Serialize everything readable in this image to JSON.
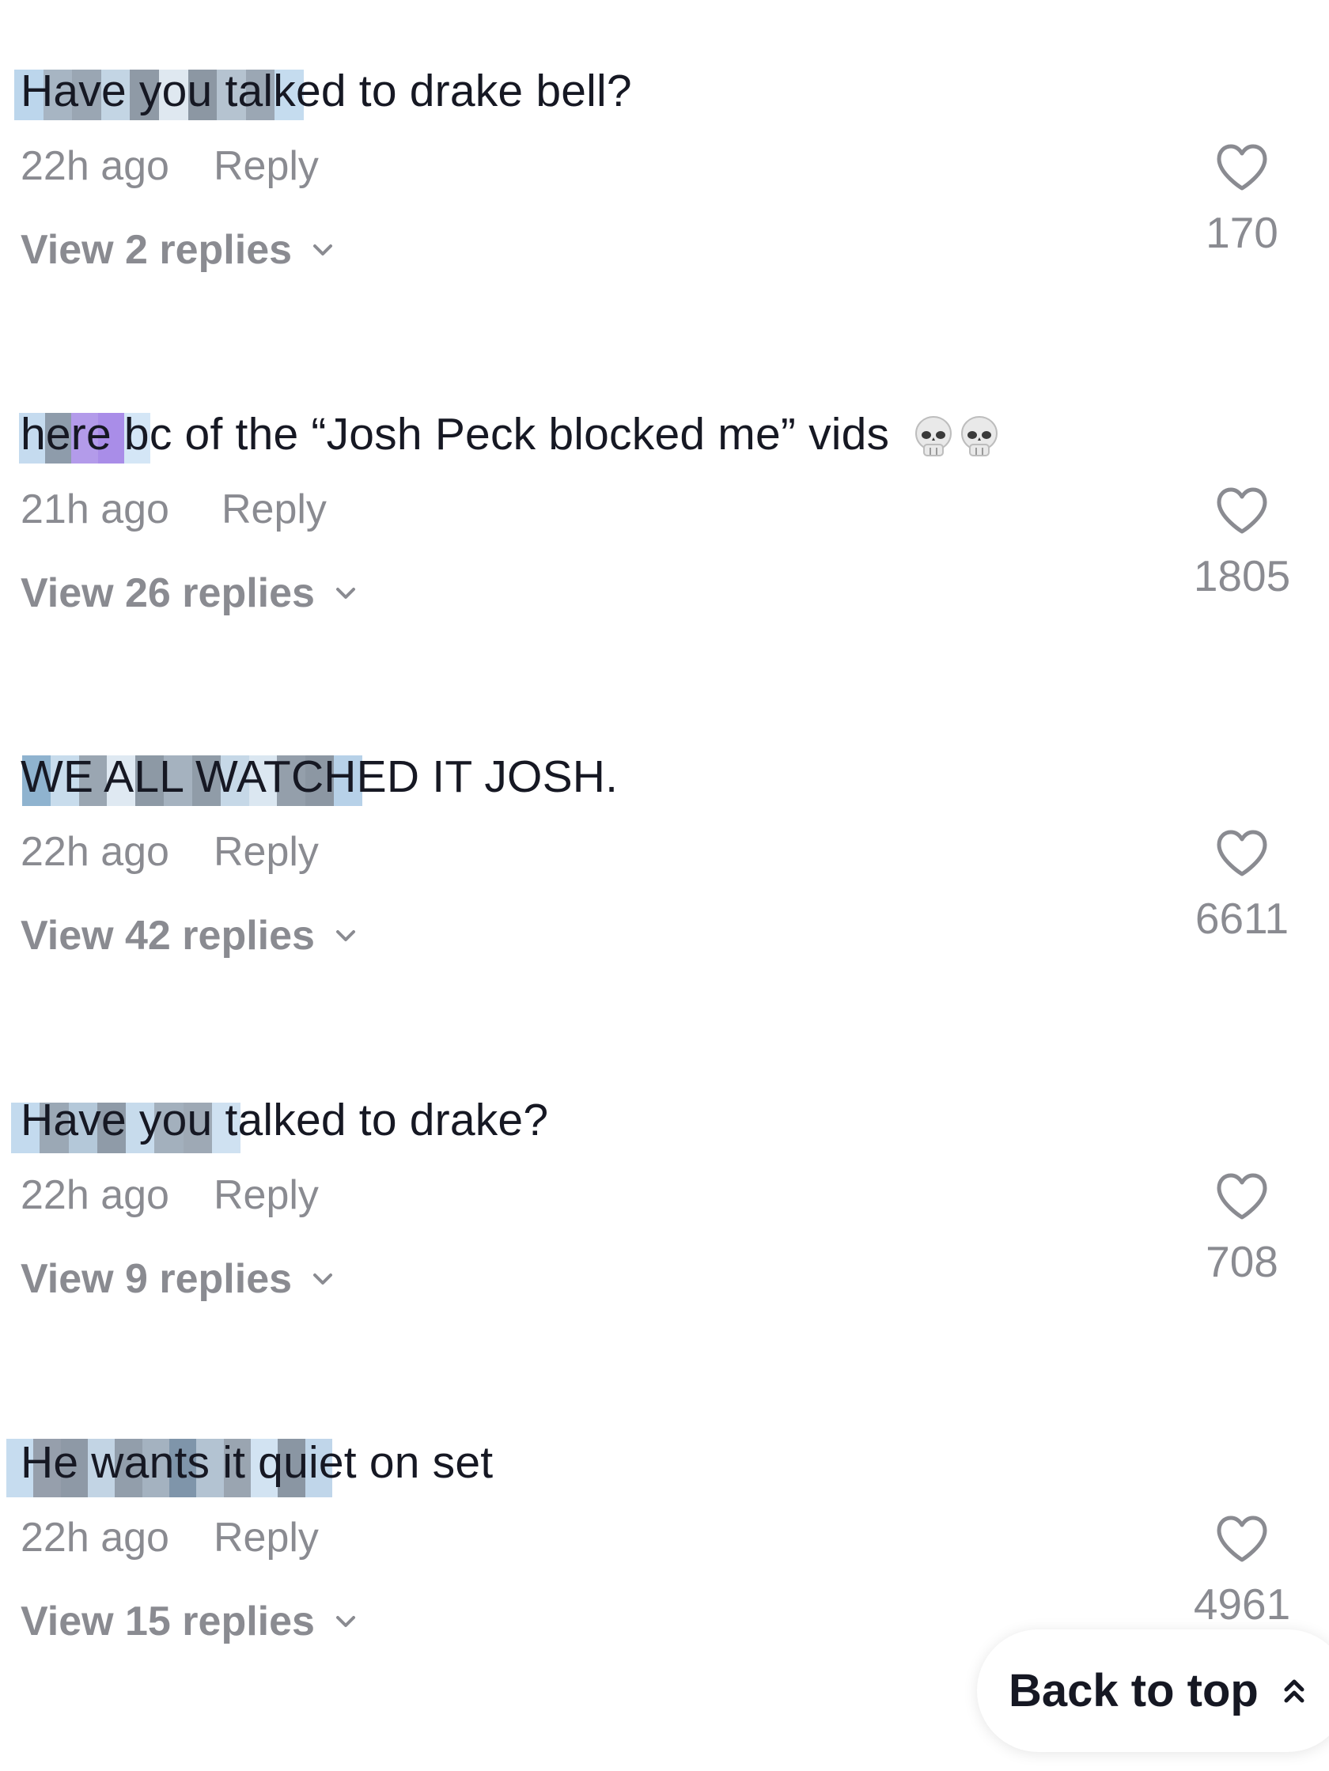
{
  "comments": [
    {
      "text": "Have you talked to drake bell?",
      "time": "22h ago",
      "reply_label": "Reply",
      "view_replies": "View 2 replies",
      "likes": "170"
    },
    {
      "text": "here bc of the “Josh Peck blocked me” vids",
      "emoji": "💀💀",
      "time": "21h ago",
      "reply_label": "Reply",
      "view_replies": "View 26 replies",
      "likes": "1805"
    },
    {
      "text": "WE ALL WATCHED IT JOSH.",
      "time": "22h ago",
      "reply_label": "Reply",
      "view_replies": "View 42 replies",
      "likes": "6611"
    },
    {
      "text": "Have you talked to drake?",
      "time": "22h ago",
      "reply_label": "Reply",
      "view_replies": "View 9 replies",
      "likes": "708"
    },
    {
      "text": "He wants it quiet on set",
      "time": "22h ago",
      "reply_label": "Reply",
      "view_replies": "View 15 replies",
      "likes": "4961"
    }
  ],
  "back_to_top": {
    "label": "Back to top",
    "icon": "double-chevron-up-icon"
  },
  "icons": {
    "like": "heart-outline-icon",
    "expand": "chevron-down-icon"
  },
  "colors": {
    "text": "#161823",
    "secondary": "#8a8b91",
    "blur_light": "#c9dff0",
    "blur_dark": "#8c98a6",
    "blur_purple": "#a98de8"
  }
}
